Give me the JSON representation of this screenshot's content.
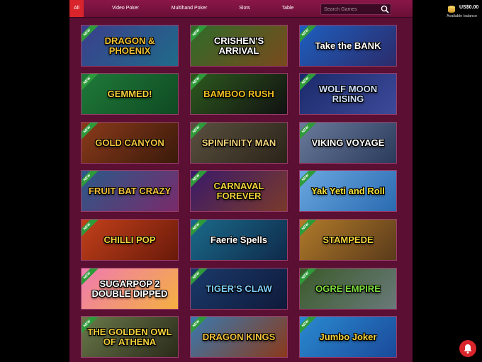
{
  "nav": {
    "tabs": [
      {
        "label": "All",
        "active": true
      },
      {
        "label": "Video Poker",
        "active": false
      },
      {
        "label": "Multihand Poker",
        "active": false
      },
      {
        "label": "Slots",
        "active": false
      },
      {
        "label": "Table",
        "active": false
      }
    ],
    "search_placeholder": "Search Games"
  },
  "balance": {
    "amount": "US$0.00",
    "label": "Available balance"
  },
  "games": [
    {
      "title": "DRAGON & PHOENIX",
      "badge": "NEW",
      "bg": [
        "#3b3f8c",
        "#1f6b8a"
      ],
      "color": "#f2c232"
    },
    {
      "title": "CRISHEN'S ARRIVAL",
      "badge": "NEW",
      "bg": [
        "#2f6b2a",
        "#7a4a1c"
      ],
      "color": "#ffffff"
    },
    {
      "title": "Take the BANK",
      "badge": "NEW",
      "bg": [
        "#1e5fbf",
        "#2b2b6a"
      ],
      "color": "#ffffff"
    },
    {
      "title": "GEMMED!",
      "badge": "NEW",
      "bg": [
        "#1f7a3a",
        "#0f4a22"
      ],
      "color": "#f4d23a"
    },
    {
      "title": "BAMBOO RUSH",
      "badge": "NEW",
      "bg": [
        "#2d5a1e",
        "#111"
      ],
      "color": "#f0c020"
    },
    {
      "title": "WOLF MOON RISING",
      "badge": "NEW",
      "bg": [
        "#1b2a6a",
        "#3d4a9a"
      ],
      "color": "#cfe0ff"
    },
    {
      "title": "GOLD CANYON",
      "badge": "NEW",
      "bg": [
        "#8a3a1a",
        "#3a1a0a"
      ],
      "color": "#f4c23a"
    },
    {
      "title": "SPINFINITY MAN",
      "badge": "NEW",
      "bg": [
        "#5a5040",
        "#2a2418"
      ],
      "color": "#f2d27a"
    },
    {
      "title": "VIKING VOYAGE",
      "badge": "NEW",
      "bg": [
        "#6a7a9a",
        "#2a3a5a"
      ],
      "color": "#ffffff"
    },
    {
      "title": "FRUIT BAT CRAZY",
      "badge": "NEW",
      "bg": [
        "#2a5a8a",
        "#7a2a6a"
      ],
      "color": "#f4c23a"
    },
    {
      "title": "CARNAVAL FOREVER",
      "badge": "NEW",
      "bg": [
        "#3a1a6a",
        "#7a3a2a"
      ],
      "color": "#f4d23a"
    },
    {
      "title": "Yak Yeti and Roll",
      "badge": "NEW",
      "bg": [
        "#6aa8e0",
        "#2a6ab0"
      ],
      "color": "#f4e23a"
    },
    {
      "title": "CHILLI POP",
      "badge": "NEW",
      "bg": [
        "#c2401a",
        "#6a1a0a"
      ],
      "color": "#f4d23a"
    },
    {
      "title": "Faerie Spells",
      "badge": "NEW",
      "bg": [
        "#1a6a8a",
        "#0f2a4a"
      ],
      "color": "#ffffff"
    },
    {
      "title": "STAMPEDE",
      "badge": "NEW",
      "bg": [
        "#b07a2a",
        "#5a3a1a"
      ],
      "color": "#f4d23a"
    },
    {
      "title": "SUGARPOP 2 DOUBLE DIPPED",
      "badge": "NEW",
      "bg": [
        "#f07ab0",
        "#f4b040"
      ],
      "color": "#ffffff"
    },
    {
      "title": "TIGER'S CLAW",
      "badge": "NEW",
      "bg": [
        "#1a3a6a",
        "#0f1a3a"
      ],
      "color": "#7fd0ff"
    },
    {
      "title": "OGRE EMPIRE",
      "badge": "NEW",
      "bg": [
        "#3a5a2a",
        "#6a7a7a"
      ],
      "color": "#7fe040"
    },
    {
      "title": "THE GOLDEN OWL OF ATHENA",
      "badge": "NEW",
      "bg": [
        "#6a7a4a",
        "#2a2a1a"
      ],
      "color": "#f4d23a"
    },
    {
      "title": "DRAGON KINGS",
      "badge": "NEW",
      "bg": [
        "#3a7ab0",
        "#8a3a1a"
      ],
      "color": "#f4c23a"
    },
    {
      "title": "Jumbo Joker",
      "badge": "NEW",
      "bg": [
        "#2a8ad0",
        "#1a4a9a"
      ],
      "color": "#f4d23a"
    }
  ]
}
